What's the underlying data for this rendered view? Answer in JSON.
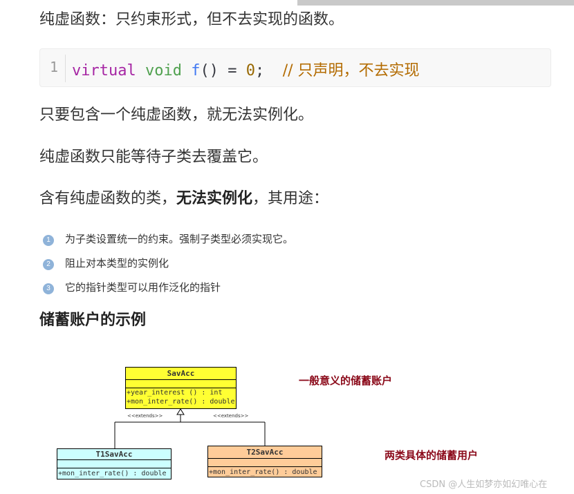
{
  "paragraphs": {
    "p1": "纯虚函数：只约束形式，但不去实现的函数。",
    "p2": "只要包含一个纯虚函数，就无法实例化。",
    "p3": "纯虚函数只能等待子类去覆盖它。",
    "p4_pre": "含有纯虚函数的类，",
    "p4_bold": "无法实例化",
    "p4_post": "，其用途："
  },
  "code": {
    "line_number": "1",
    "keyword": "virtual",
    "type": "void",
    "func": "f",
    "parens": "()",
    "equals": "=",
    "zero": "0",
    "semicolon": ";",
    "comment": "// 只声明，不去实现"
  },
  "list": [
    {
      "num": "1",
      "text": "为子类设置统一的约束。强制子类型必须实现它。"
    },
    {
      "num": "2",
      "text": "阻止对本类型的实例化"
    },
    {
      "num": "3",
      "text": "它的指针类型可以用作泛化的指针"
    }
  ],
  "section_title": "储蓄账户的示例",
  "uml": {
    "base": {
      "name": "SavAcc",
      "methods": [
        "+year_interest () : int",
        "+mon_inter_rate() : double"
      ],
      "color": "#ffff33"
    },
    "left": {
      "name": "T1SavAcc",
      "methods": [
        "+mon_inter_rate() : double"
      ],
      "color": "#ccffff"
    },
    "right": {
      "name": "T2SavAcc",
      "methods": [
        "+mon_inter_rate() : double"
      ],
      "color": "#ffcc99"
    },
    "stereotype": "<<extends>>",
    "note_base": "一般意义的储蓄账户",
    "note_subclasses": "两类具体的储蓄用户"
  },
  "watermark": "CSDN @人生如梦亦如幻唯心在"
}
